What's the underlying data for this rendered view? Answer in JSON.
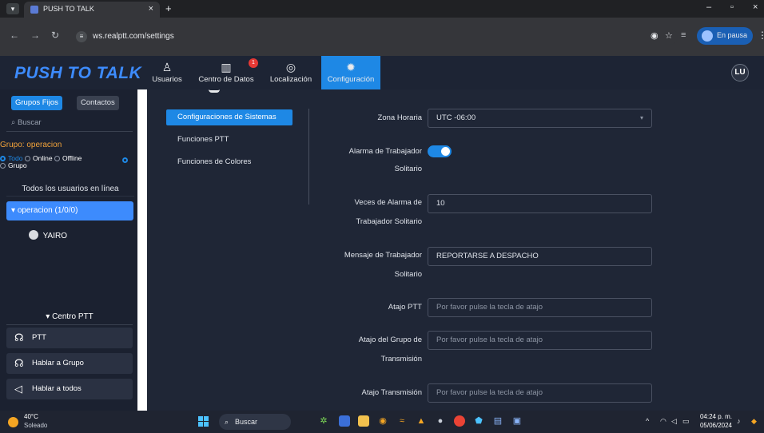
{
  "browser": {
    "tab_title": "PUSH TO TALK",
    "url": "ws.realptt.com/settings",
    "profile_label": "En pausa"
  },
  "header": {
    "logo": "PUSH TO TALK",
    "nav": [
      {
        "label": "Usuarios",
        "icon": "user-icon"
      },
      {
        "label": "Centro de Datos",
        "icon": "bar-chart-icon"
      },
      {
        "label": "Localización",
        "icon": "location-pin-icon"
      },
      {
        "label": "Configuración",
        "icon": "gear-icon"
      }
    ],
    "notification_count": "1",
    "user_initials": "LU",
    "active_nav": "Configuración"
  },
  "sidebar": {
    "tabs": [
      "Grupos Fijos",
      "Contactos"
    ],
    "search_placeholder": "Buscar",
    "group_label": "Grupo: operacion",
    "filters": [
      "Todo",
      "Online",
      "Offline"
    ],
    "filter_extra": "Grupo",
    "all_users": "Todos los usuarios en línea",
    "group_item": "operacion (1/0/0)",
    "user_name": "YAIRO",
    "centro_ptt": "Centro PTT",
    "actions": [
      {
        "label": "PTT",
        "icon": "ptt-icon"
      },
      {
        "label": "Hablar a Grupo",
        "icon": "group-talk-icon"
      },
      {
        "label": "Hablar a todos",
        "icon": "broadcast-icon"
      }
    ]
  },
  "settings_menu": {
    "items": [
      "Configuraciones de Sistemas",
      "Funciones PTT",
      "Funciones de Colores"
    ],
    "active": "Configuraciones de Sistemas"
  },
  "form": {
    "timezone_label": "Zona Horaria",
    "timezone_value": "UTC -06:00",
    "lone_alarm_label_1": "Alarma de Trabajador",
    "lone_alarm_label_2": "Solitario",
    "lone_alarm_enabled": true,
    "alarm_count_label_1": "Veces de Alarma de",
    "alarm_count_label_2": "Trabajador Solitario",
    "alarm_count_value": "10",
    "message_label_1": "Mensaje de Trabajador",
    "message_label_2": "Solitario",
    "message_value": "REPORTARSE A DESPACHO",
    "ptt_shortcut_label": "Atajo PTT",
    "ptt_shortcut_placeholder": "Por favor pulse la tecla de atajo",
    "group_shortcut_label_1": "Atajo del Grupo de",
    "group_shortcut_label_2": "Transmisión",
    "group_shortcut_placeholder": "Por favor pulse la tecla de atajo",
    "transmission_shortcut_label": "Atajo Transmisión",
    "transmission_shortcut_placeholder": "Por favor pulse la tecla de atajo"
  },
  "taskbar": {
    "temperature": "40°C",
    "weather": "Soleado",
    "search_label": "Buscar",
    "time": "04:24 p. m.",
    "date": "05/06/2024"
  },
  "colors": {
    "accent": "#1e88e5",
    "logo": "#3d8bfd",
    "group_label": "#f2a33a",
    "badge": "#e53935"
  }
}
